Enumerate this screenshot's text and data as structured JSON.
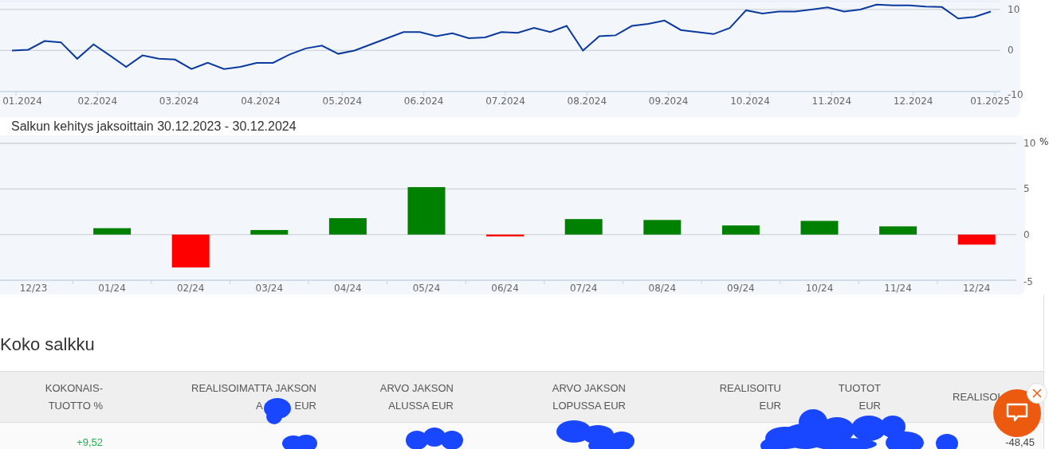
{
  "performance_chart": {
    "chart_data": {
      "type": "line",
      "categories": [
        "01.2024",
        null,
        null,
        null,
        null,
        "02.2024",
        null,
        null,
        null,
        null,
        "03.2024",
        null,
        null,
        null,
        null,
        "04.2024",
        null,
        null,
        null,
        null,
        "05.2024",
        null,
        null,
        null,
        null,
        "06.2024",
        null,
        null,
        null,
        null,
        "07.2024",
        null,
        null,
        null,
        null,
        "08.2024",
        null,
        null,
        null,
        null,
        "09.2024",
        null,
        null,
        null,
        null,
        "10.2024",
        null,
        null,
        null,
        null,
        "11.2024",
        null,
        null,
        null,
        null,
        "12.2024",
        null,
        null,
        null,
        null,
        "01.2025"
      ],
      "series": [
        {
          "color": "#0b3a9e",
          "values": [
            0,
            0.2,
            2.3,
            2.0,
            -2.0,
            1.5,
            -1.2,
            -4.0,
            -1.2,
            -2.0,
            -2.2,
            -4.5,
            -3.0,
            -4.5,
            -4.0,
            -3.0,
            -3.0,
            -1.0,
            0.5,
            1.2,
            -0.8,
            0,
            1.5,
            3.0,
            4.5,
            4.5,
            3.5,
            4.2,
            3.0,
            3.2,
            4.5,
            4.3,
            5.5,
            4.5,
            6.0,
            0,
            3.5,
            3.7,
            6.0,
            6.5,
            7.3,
            5.0,
            4.5,
            4.0,
            5.5,
            9.8,
            9.0,
            9.5,
            9.5,
            10.0,
            10.5,
            9.5,
            10.0,
            11.2,
            11.0,
            11.0,
            10.7,
            10.6,
            7.8,
            8.2,
            9.5
          ]
        }
      ],
      "ylim": [
        -10,
        12
      ],
      "yticks": [
        -10,
        0,
        10
      ]
    }
  },
  "period_chart": {
    "title": "Salkun kehitys jaksoittain 30.12.2023 - 30.12.2024",
    "unit": "%",
    "chart_data": {
      "type": "bar",
      "categories": [
        "12/23",
        "01/24",
        "02/24",
        "03/24",
        "04/24",
        "05/24",
        "06/24",
        "07/24",
        "08/24",
        "09/24",
        "10/24",
        "11/24",
        "12/24"
      ],
      "series": [
        {
          "color": "#008000",
          "values": [
            null,
            0.7,
            null,
            0.5,
            1.8,
            5.2,
            null,
            1.7,
            1.6,
            1.0,
            1.5,
            0.9,
            null
          ]
        },
        {
          "color": "#ff0000",
          "values": [
            null,
            null,
            -3.6,
            null,
            null,
            null,
            -0.2,
            null,
            null,
            null,
            null,
            null,
            -1.1
          ]
        }
      ],
      "ylim": [
        -5,
        10
      ],
      "yticks": [
        -5,
        0,
        5,
        10
      ]
    }
  },
  "portfolio": {
    "title": "Koko salkku",
    "columns": [
      {
        "lines": [
          "KOKONAIS-",
          "TUOTTO %"
        ]
      },
      {
        "lines": [
          "REALISOIMATTA JAKSON",
          [
            "A",
            "EUR"
          ]
        ]
      },
      {
        "lines": [
          "ARVO JAKSON",
          "ALUSSA EUR"
        ]
      },
      {
        "lines": [
          "ARVO JAKSON",
          "LOPUSSA EUR"
        ]
      },
      {
        "lines": [
          "REALISOITU",
          "EUR"
        ]
      },
      {
        "lines": [
          "TUOTOT",
          "EUR"
        ]
      },
      {
        "lines": [
          "REALISOI"
        ]
      }
    ],
    "rows": [
      {
        "cells": [
          {
            "text": "+9,52",
            "color": "#1db34a"
          },
          {},
          {},
          {},
          {},
          {},
          {
            "text": "-48,45",
            "color": "#444444"
          }
        ]
      }
    ]
  }
}
